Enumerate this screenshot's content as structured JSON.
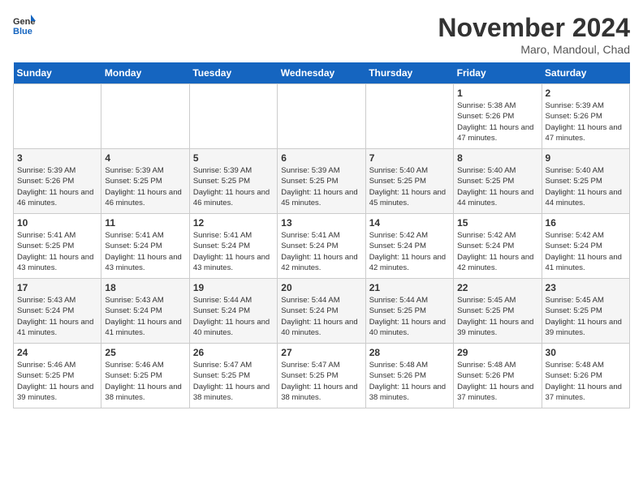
{
  "header": {
    "logo_line1": "General",
    "logo_line2": "Blue",
    "month_title": "November 2024",
    "location": "Maro, Mandoul, Chad"
  },
  "weekdays": [
    "Sunday",
    "Monday",
    "Tuesday",
    "Wednesday",
    "Thursday",
    "Friday",
    "Saturday"
  ],
  "weeks": [
    [
      {
        "day": "",
        "info": ""
      },
      {
        "day": "",
        "info": ""
      },
      {
        "day": "",
        "info": ""
      },
      {
        "day": "",
        "info": ""
      },
      {
        "day": "",
        "info": ""
      },
      {
        "day": "1",
        "info": "Sunrise: 5:38 AM\nSunset: 5:26 PM\nDaylight: 11 hours and 47 minutes."
      },
      {
        "day": "2",
        "info": "Sunrise: 5:39 AM\nSunset: 5:26 PM\nDaylight: 11 hours and 47 minutes."
      }
    ],
    [
      {
        "day": "3",
        "info": "Sunrise: 5:39 AM\nSunset: 5:26 PM\nDaylight: 11 hours and 46 minutes."
      },
      {
        "day": "4",
        "info": "Sunrise: 5:39 AM\nSunset: 5:25 PM\nDaylight: 11 hours and 46 minutes."
      },
      {
        "day": "5",
        "info": "Sunrise: 5:39 AM\nSunset: 5:25 PM\nDaylight: 11 hours and 46 minutes."
      },
      {
        "day": "6",
        "info": "Sunrise: 5:39 AM\nSunset: 5:25 PM\nDaylight: 11 hours and 45 minutes."
      },
      {
        "day": "7",
        "info": "Sunrise: 5:40 AM\nSunset: 5:25 PM\nDaylight: 11 hours and 45 minutes."
      },
      {
        "day": "8",
        "info": "Sunrise: 5:40 AM\nSunset: 5:25 PM\nDaylight: 11 hours and 44 minutes."
      },
      {
        "day": "9",
        "info": "Sunrise: 5:40 AM\nSunset: 5:25 PM\nDaylight: 11 hours and 44 minutes."
      }
    ],
    [
      {
        "day": "10",
        "info": "Sunrise: 5:41 AM\nSunset: 5:25 PM\nDaylight: 11 hours and 43 minutes."
      },
      {
        "day": "11",
        "info": "Sunrise: 5:41 AM\nSunset: 5:24 PM\nDaylight: 11 hours and 43 minutes."
      },
      {
        "day": "12",
        "info": "Sunrise: 5:41 AM\nSunset: 5:24 PM\nDaylight: 11 hours and 43 minutes."
      },
      {
        "day": "13",
        "info": "Sunrise: 5:41 AM\nSunset: 5:24 PM\nDaylight: 11 hours and 42 minutes."
      },
      {
        "day": "14",
        "info": "Sunrise: 5:42 AM\nSunset: 5:24 PM\nDaylight: 11 hours and 42 minutes."
      },
      {
        "day": "15",
        "info": "Sunrise: 5:42 AM\nSunset: 5:24 PM\nDaylight: 11 hours and 42 minutes."
      },
      {
        "day": "16",
        "info": "Sunrise: 5:42 AM\nSunset: 5:24 PM\nDaylight: 11 hours and 41 minutes."
      }
    ],
    [
      {
        "day": "17",
        "info": "Sunrise: 5:43 AM\nSunset: 5:24 PM\nDaylight: 11 hours and 41 minutes."
      },
      {
        "day": "18",
        "info": "Sunrise: 5:43 AM\nSunset: 5:24 PM\nDaylight: 11 hours and 41 minutes."
      },
      {
        "day": "19",
        "info": "Sunrise: 5:44 AM\nSunset: 5:24 PM\nDaylight: 11 hours and 40 minutes."
      },
      {
        "day": "20",
        "info": "Sunrise: 5:44 AM\nSunset: 5:24 PM\nDaylight: 11 hours and 40 minutes."
      },
      {
        "day": "21",
        "info": "Sunrise: 5:44 AM\nSunset: 5:25 PM\nDaylight: 11 hours and 40 minutes."
      },
      {
        "day": "22",
        "info": "Sunrise: 5:45 AM\nSunset: 5:25 PM\nDaylight: 11 hours and 39 minutes."
      },
      {
        "day": "23",
        "info": "Sunrise: 5:45 AM\nSunset: 5:25 PM\nDaylight: 11 hours and 39 minutes."
      }
    ],
    [
      {
        "day": "24",
        "info": "Sunrise: 5:46 AM\nSunset: 5:25 PM\nDaylight: 11 hours and 39 minutes."
      },
      {
        "day": "25",
        "info": "Sunrise: 5:46 AM\nSunset: 5:25 PM\nDaylight: 11 hours and 38 minutes."
      },
      {
        "day": "26",
        "info": "Sunrise: 5:47 AM\nSunset: 5:25 PM\nDaylight: 11 hours and 38 minutes."
      },
      {
        "day": "27",
        "info": "Sunrise: 5:47 AM\nSunset: 5:25 PM\nDaylight: 11 hours and 38 minutes."
      },
      {
        "day": "28",
        "info": "Sunrise: 5:48 AM\nSunset: 5:26 PM\nDaylight: 11 hours and 38 minutes."
      },
      {
        "day": "29",
        "info": "Sunrise: 5:48 AM\nSunset: 5:26 PM\nDaylight: 11 hours and 37 minutes."
      },
      {
        "day": "30",
        "info": "Sunrise: 5:48 AM\nSunset: 5:26 PM\nDaylight: 11 hours and 37 minutes."
      }
    ]
  ]
}
